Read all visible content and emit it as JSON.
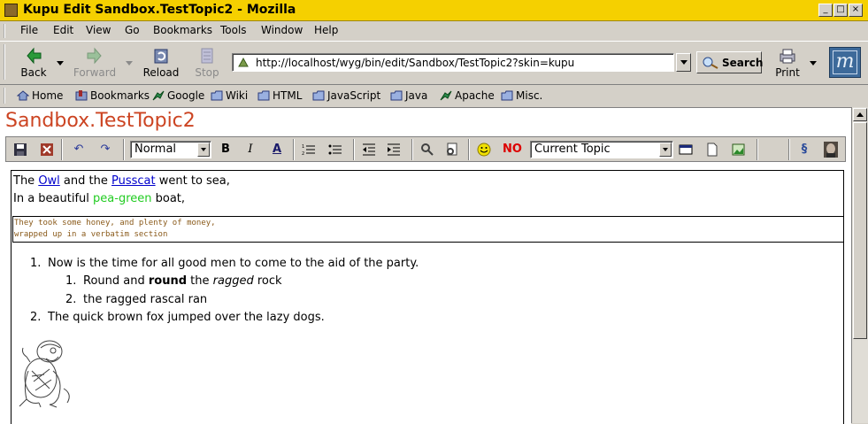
{
  "window": {
    "title": "Kupu Edit Sandbox.TestTopic2 - Mozilla",
    "minimize": "_",
    "maximize": "□",
    "close": "×"
  },
  "menu": [
    "File",
    "Edit",
    "View",
    "Go",
    "Bookmarks",
    "Tools",
    "Window",
    "Help"
  ],
  "nav": {
    "back": "Back",
    "forward": "Forward",
    "reload": "Reload",
    "stop": "Stop",
    "url": "http://localhost/wyg/bin/edit/Sandbox/TestTopic2?skin=kupu",
    "search": "Search",
    "print": "Print"
  },
  "personal": [
    "Home",
    "Bookmarks",
    "Google",
    "Wiki",
    "HTML",
    "JavaScript",
    "Java",
    "Apache",
    "Misc."
  ],
  "page": {
    "title": "Sandbox.TestTopic2"
  },
  "kupu": {
    "style_select": "Normal",
    "bold": "B",
    "italic": "I",
    "text_color": "A",
    "no_label": "NO",
    "topic_select": "Current Topic"
  },
  "doc": {
    "line1_pre": "The ",
    "line1_link1": "Owl",
    "line1_mid": " and the ",
    "line1_link2": "Pusscat",
    "line1_post": " went to sea,",
    "line2_pre": "In a beautiful ",
    "line2_green": "pea-green",
    "line2_post": " boat,",
    "verbatim1": "They took some honey, and plenty of money,",
    "verbatim2": "wrapped up in a verbatim section",
    "li1_num": "1.",
    "li1": "Now is the time for all good men to come to the aid of the party.",
    "li1a_num": "1.",
    "li1a_pre": "Round and ",
    "li1a_bold": "round",
    "li1a_mid": " the ",
    "li1a_ital": "ragged",
    "li1a_post": " rock",
    "li1b_num": "2.",
    "li1b": "the ragged rascal ran",
    "li2_num": "2.",
    "li2": "The quick brown fox jumped over the lazy dogs."
  },
  "colors": {
    "titlebar": "#f5d000",
    "page_title": "#cc4422",
    "link": "#0000cc",
    "green_text": "#22cc22",
    "verbatim_text": "#8a5a1a",
    "no_text": "#dd0000"
  }
}
